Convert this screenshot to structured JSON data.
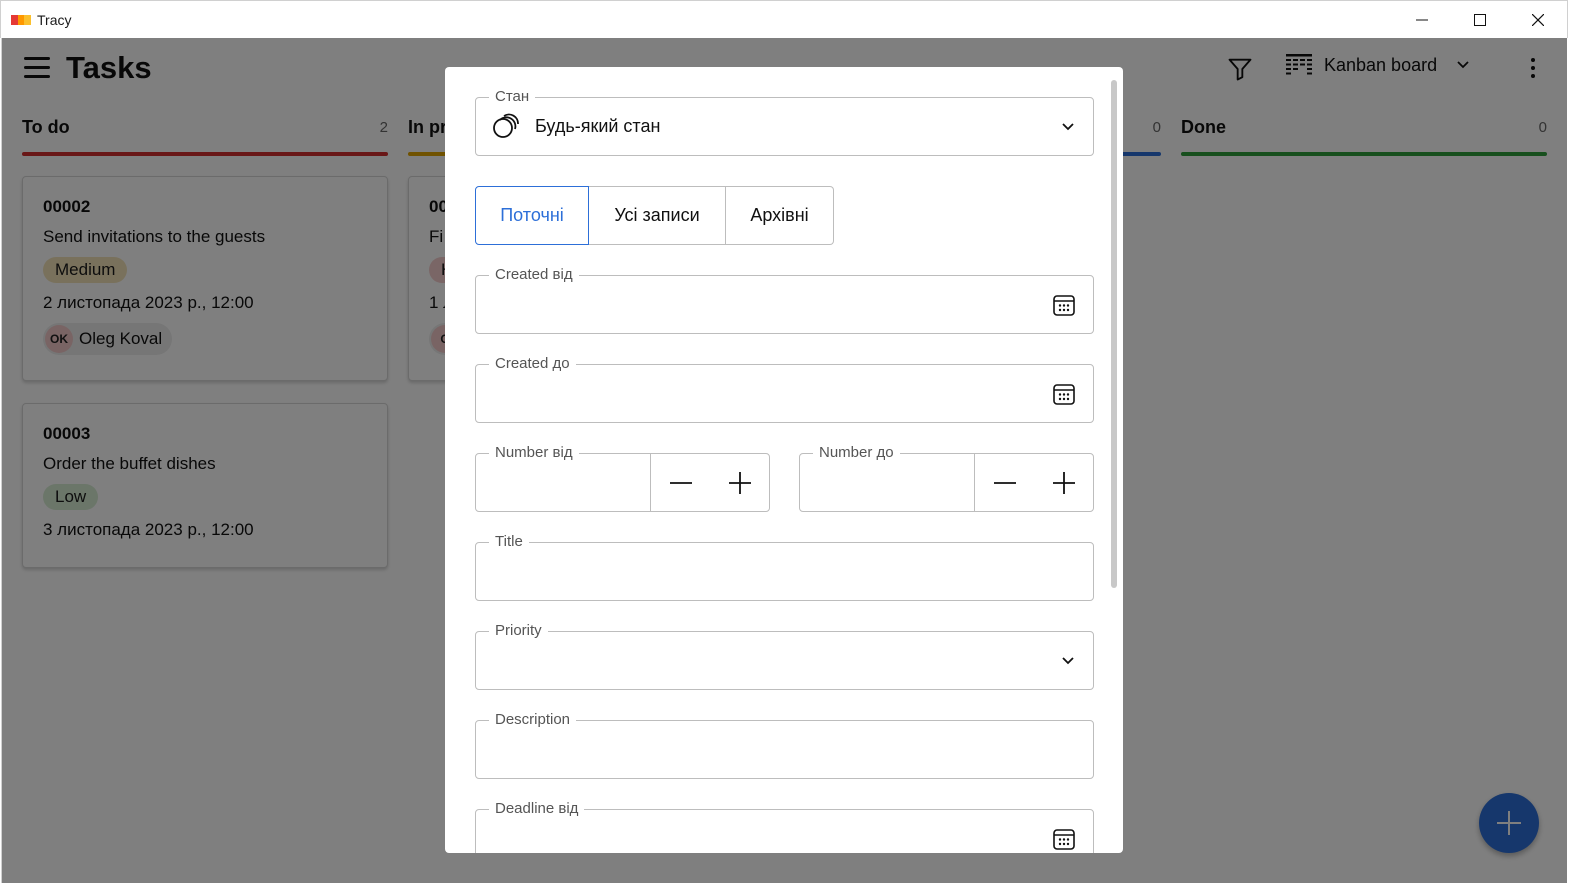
{
  "window": {
    "title": "Tracy",
    "logo_colors": [
      "#e53935",
      "#fbc02d",
      "#ff9800"
    ]
  },
  "header": {
    "title": "Tasks",
    "view_label": "Kanban board"
  },
  "columns": [
    {
      "name": "To do",
      "count": "2",
      "color": "#d32f2f"
    },
    {
      "name": "In pr",
      "count": "",
      "color": "#e0a400"
    },
    {
      "name": "",
      "count": "0",
      "color": "#2d6fd8"
    },
    {
      "name": "Done",
      "count": "0",
      "color": "#2e9e3a"
    }
  ],
  "cards": [
    {
      "number": "00002",
      "title": "Send invitations to the guests",
      "priority": "Medium",
      "priority_color": "#f3e3b8",
      "date": "2 листопада 2023 р., 12:00",
      "user_initials": "OK",
      "user_name": "Oleg Koval"
    },
    {
      "number": "00003",
      "title": "Order the buffet dishes",
      "priority": "Low",
      "priority_color": "#d6ecd2",
      "date": "3 листопада 2023 р., 12:00"
    },
    {
      "number": "00",
      "title": "Fi",
      "priority": "H",
      "priority_color": "#f4cccc",
      "date": "1 л",
      "user_initials": "O"
    }
  ],
  "dialog": {
    "state": {
      "label": "Стан",
      "value": "Будь-який стан"
    },
    "segments": [
      "Поточні",
      "Усі записи",
      "Архівні"
    ],
    "created_from": {
      "label": "Created від",
      "value": ""
    },
    "created_to": {
      "label": "Created до",
      "value": ""
    },
    "number_from": {
      "label": "Number від",
      "value": ""
    },
    "number_to": {
      "label": "Number до",
      "value": ""
    },
    "title": {
      "label": "Title",
      "value": ""
    },
    "priority": {
      "label": "Priority",
      "value": ""
    },
    "description": {
      "label": "Description",
      "value": ""
    },
    "deadline_from": {
      "label": "Deadline від",
      "value": ""
    }
  },
  "colors": {
    "accent": "#2d6fd8",
    "fab": "#2d6fd8"
  }
}
